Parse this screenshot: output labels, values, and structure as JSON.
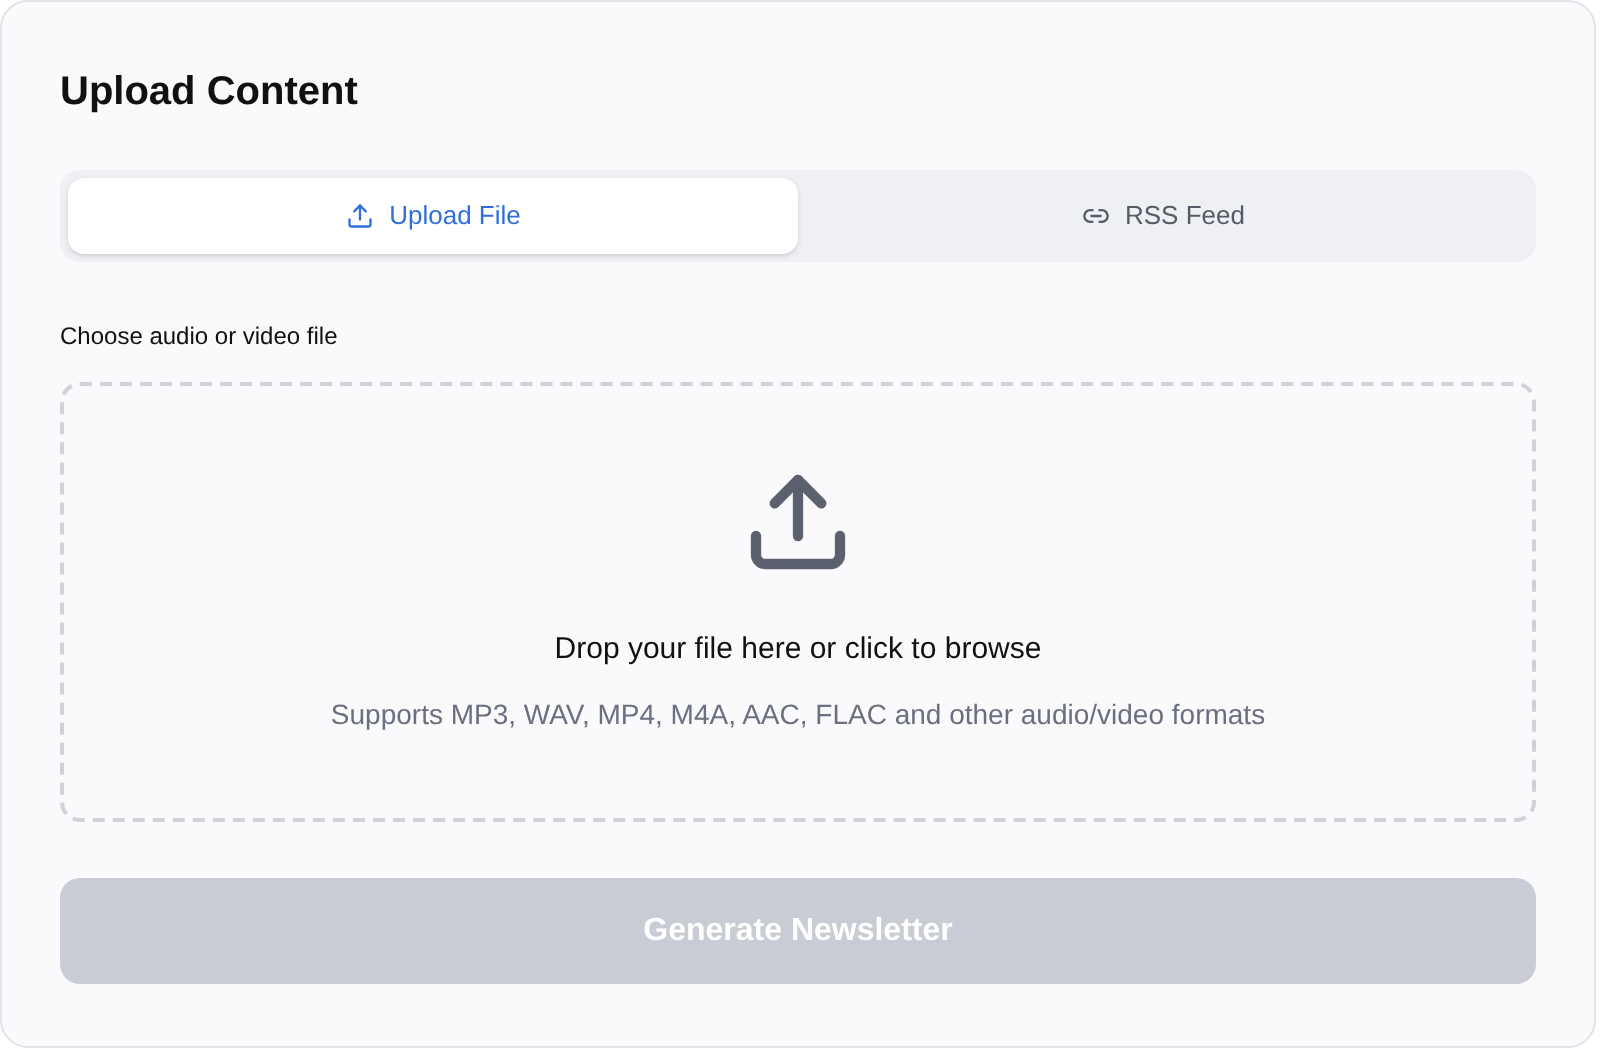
{
  "title": "Upload Content",
  "tabs": [
    {
      "label": "Upload File",
      "kind": "upload",
      "selected": true
    },
    {
      "label": "RSS Feed",
      "kind": "link",
      "selected": false
    }
  ],
  "field_label": "Choose audio or video file",
  "dropzone": {
    "heading": "Drop your file here or click to browse",
    "hint": "Supports MP3, WAV, MP4, M4A, AAC, FLAC and other audio/video formats"
  },
  "submit": {
    "label": "Generate Newsletter",
    "disabled": true
  }
}
